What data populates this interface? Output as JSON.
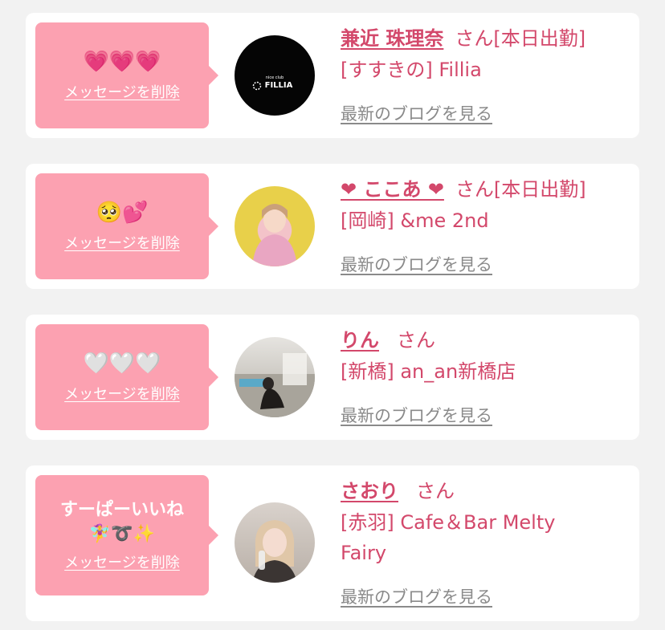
{
  "cards": [
    {
      "message": "💗💗💗",
      "delete_label": "メッセージを削除",
      "name": "兼近 珠理奈",
      "suffix": "さん[本日出勤]",
      "shop": "[すすきの] Fillia",
      "blog_label": "最新のブログを見る",
      "avatar_logo": "FILLIA",
      "avatar_logo_small": "nice club"
    },
    {
      "message": "🥺💕",
      "delete_label": "メッセージを削除",
      "name": "❤ ここあ ❤",
      "suffix": "さん[本日出勤]",
      "shop": "[岡崎] &me 2nd",
      "blog_label": "最新のブログを見る"
    },
    {
      "message": "🤍🤍🤍",
      "delete_label": "メッセージを削除",
      "name": "りん",
      "suffix": "さん",
      "shop": "[新橋] an_an新橋店",
      "blog_label": "最新のブログを見る"
    },
    {
      "message": "すーぱーいいね",
      "message_emoji": "🧚‍♀️➰✨",
      "delete_label": "メッセージを削除",
      "name": "さおり",
      "suffix": "さん",
      "shop_line1": "[赤羽] Cafe＆Bar Melty",
      "shop_line2": "Fairy",
      "blog_label": "最新のブログを見る"
    }
  ],
  "colors": {
    "bubble": "#fca1b1",
    "accent": "#d3486b",
    "link_gray": "#8a8a8a",
    "background": "#f2f2f2"
  }
}
